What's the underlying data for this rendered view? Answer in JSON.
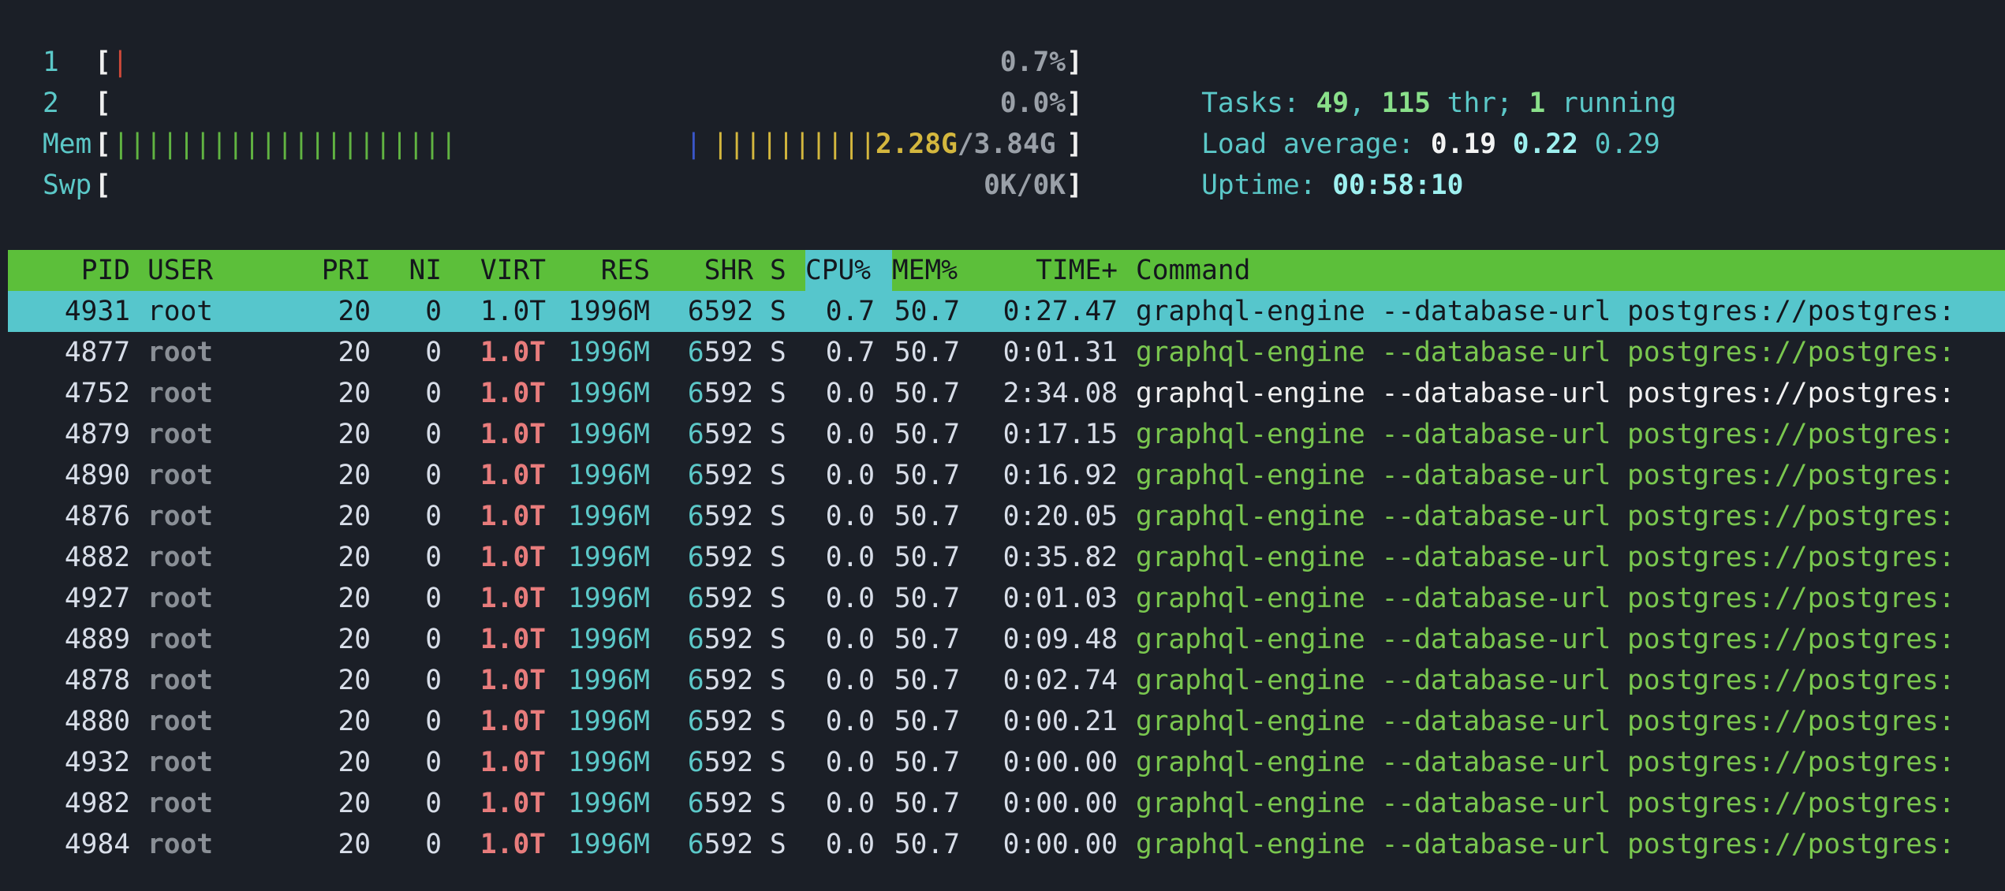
{
  "meters": {
    "cpu1": {
      "label": "1",
      "value": "0.7%"
    },
    "cpu2": {
      "label": "2",
      "value": "0.0%"
    },
    "mem": {
      "label": "Mem",
      "used": "2.28G",
      "sep": "/",
      "total": "3.84G"
    },
    "swp": {
      "label": "Swp",
      "value": "0K/0K"
    }
  },
  "stats": {
    "tasks_label": "Tasks: ",
    "tasks": "49",
    "comma": ", ",
    "threads": "115",
    "thr_label": " thr; ",
    "running": "1",
    "running_label": " running",
    "load_label": "Load average: ",
    "load1": "0.19",
    "load5": "0.22",
    "load15": "0.29",
    "uptime_label": "Uptime: ",
    "uptime": "00:58:10"
  },
  "columns": {
    "pid": "PID",
    "user": "USER",
    "pri": "PRI",
    "ni": "NI",
    "virt": "VIRT",
    "res": "RES",
    "shr": "SHR",
    "s": "S",
    "cpu": "CPU%",
    "mem": "MEM%",
    "time": "TIME+",
    "command": "Command"
  },
  "processes": [
    {
      "pid": "4931",
      "user": "root",
      "pri": "20",
      "ni": "0",
      "virt": "1.0T",
      "res": "1996M",
      "shr": "6592",
      "s": "S",
      "cpu": "0.7",
      "mem": "50.7",
      "time": "0:27.47",
      "cmd_name": "graphql-engine",
      "cmd_args": " --database-url postgres://postgres:"
    },
    {
      "pid": "4877",
      "user": "root",
      "pri": "20",
      "ni": "0",
      "virt": "1.0T",
      "res": "1996M",
      "shr": "6592",
      "s": "S",
      "cpu": "0.7",
      "mem": "50.7",
      "time": "0:01.31",
      "cmd_name": "graphql-engine",
      "cmd_args": " --database-url postgres://postgres:"
    },
    {
      "pid": "4752",
      "user": "root",
      "pri": "20",
      "ni": "0",
      "virt": "1.0T",
      "res": "1996M",
      "shr": "6592",
      "s": "S",
      "cpu": "0.0",
      "mem": "50.7",
      "time": "2:34.08",
      "cmd_name": "graphql-engine",
      "cmd_args": " --database-url postgres://postgres:"
    },
    {
      "pid": "4879",
      "user": "root",
      "pri": "20",
      "ni": "0",
      "virt": "1.0T",
      "res": "1996M",
      "shr": "6592",
      "s": "S",
      "cpu": "0.0",
      "mem": "50.7",
      "time": "0:17.15",
      "cmd_name": "graphql-engine",
      "cmd_args": " --database-url postgres://postgres:"
    },
    {
      "pid": "4890",
      "user": "root",
      "pri": "20",
      "ni": "0",
      "virt": "1.0T",
      "res": "1996M",
      "shr": "6592",
      "s": "S",
      "cpu": "0.0",
      "mem": "50.7",
      "time": "0:16.92",
      "cmd_name": "graphql-engine",
      "cmd_args": " --database-url postgres://postgres:"
    },
    {
      "pid": "4876",
      "user": "root",
      "pri": "20",
      "ni": "0",
      "virt": "1.0T",
      "res": "1996M",
      "shr": "6592",
      "s": "S",
      "cpu": "0.0",
      "mem": "50.7",
      "time": "0:20.05",
      "cmd_name": "graphql-engine",
      "cmd_args": " --database-url postgres://postgres:"
    },
    {
      "pid": "4882",
      "user": "root",
      "pri": "20",
      "ni": "0",
      "virt": "1.0T",
      "res": "1996M",
      "shr": "6592",
      "s": "S",
      "cpu": "0.0",
      "mem": "50.7",
      "time": "0:35.82",
      "cmd_name": "graphql-engine",
      "cmd_args": " --database-url postgres://postgres:"
    },
    {
      "pid": "4927",
      "user": "root",
      "pri": "20",
      "ni": "0",
      "virt": "1.0T",
      "res": "1996M",
      "shr": "6592",
      "s": "S",
      "cpu": "0.0",
      "mem": "50.7",
      "time": "0:01.03",
      "cmd_name": "graphql-engine",
      "cmd_args": " --database-url postgres://postgres:"
    },
    {
      "pid": "4889",
      "user": "root",
      "pri": "20",
      "ni": "0",
      "virt": "1.0T",
      "res": "1996M",
      "shr": "6592",
      "s": "S",
      "cpu": "0.0",
      "mem": "50.7",
      "time": "0:09.48",
      "cmd_name": "graphql-engine",
      "cmd_args": " --database-url postgres://postgres:"
    },
    {
      "pid": "4878",
      "user": "root",
      "pri": "20",
      "ni": "0",
      "virt": "1.0T",
      "res": "1996M",
      "shr": "6592",
      "s": "S",
      "cpu": "0.0",
      "mem": "50.7",
      "time": "0:02.74",
      "cmd_name": "graphql-engine",
      "cmd_args": " --database-url postgres://postgres:"
    },
    {
      "pid": "4880",
      "user": "root",
      "pri": "20",
      "ni": "0",
      "virt": "1.0T",
      "res": "1996M",
      "shr": "6592",
      "s": "S",
      "cpu": "0.0",
      "mem": "50.7",
      "time": "0:00.21",
      "cmd_name": "graphql-engine",
      "cmd_args": " --database-url postgres://postgres:"
    },
    {
      "pid": "4932",
      "user": "root",
      "pri": "20",
      "ni": "0",
      "virt": "1.0T",
      "res": "1996M",
      "shr": "6592",
      "s": "S",
      "cpu": "0.0",
      "mem": "50.7",
      "time": "0:00.00",
      "cmd_name": "graphql-engine",
      "cmd_args": " --database-url postgres://postgres:"
    },
    {
      "pid": "4982",
      "user": "root",
      "pri": "20",
      "ni": "0",
      "virt": "1.0T",
      "res": "1996M",
      "shr": "6592",
      "s": "S",
      "cpu": "0.0",
      "mem": "50.7",
      "time": "0:00.00",
      "cmd_name": "graphql-engine",
      "cmd_args": " --database-url postgres://postgres:"
    },
    {
      "pid": "4984",
      "user": "root",
      "pri": "20",
      "ni": "0",
      "virt": "1.0T",
      "res": "1996M",
      "shr": "6592",
      "s": "S",
      "cpu": "0.0",
      "mem": "50.7",
      "time": "0:00.00",
      "cmd_name": "graphql-engine",
      "cmd_args": " --database-url postgres://postgres:"
    }
  ]
}
